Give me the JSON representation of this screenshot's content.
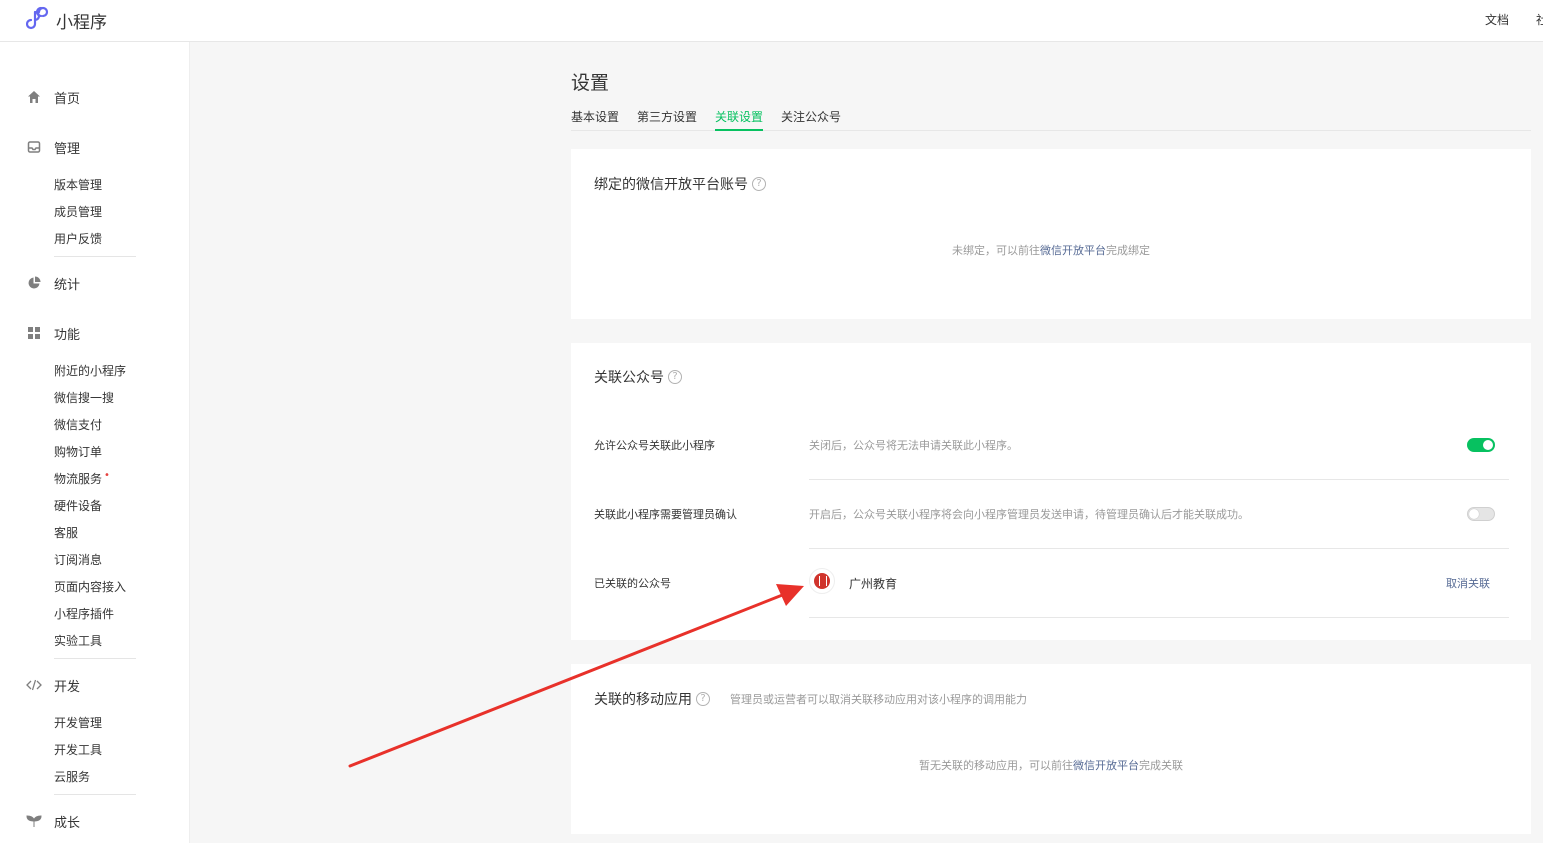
{
  "header": {
    "app_name": "小程序",
    "docs_link": "文档",
    "cut_link": "社"
  },
  "sidebar": {
    "home": "首页",
    "manage": {
      "label": "管理",
      "items": [
        "版本管理",
        "成员管理",
        "用户反馈"
      ]
    },
    "stats": "统计",
    "features": {
      "label": "功能",
      "items": [
        "附近的小程序",
        "微信搜一搜",
        "微信支付",
        "购物订单",
        "物流服务",
        "硬件设备",
        "客服",
        "订阅消息",
        "页面内容接入",
        "小程序插件",
        "实验工具"
      ],
      "badge": "•"
    },
    "dev": {
      "label": "开发",
      "items": [
        "开发管理",
        "开发工具",
        "云服务"
      ]
    },
    "growth": "成长"
  },
  "page": {
    "title": "设置",
    "tabs": [
      "基本设置",
      "第三方设置",
      "关联设置",
      "关注公众号"
    ],
    "active_tab": 2
  },
  "open_platform": {
    "title": "绑定的微信开放平台账号",
    "help": "?",
    "empty_prefix": "未绑定，可以前往",
    "empty_link": "微信开放平台",
    "empty_suffix": "完成绑定"
  },
  "official_account": {
    "title": "关联公众号",
    "help": "?",
    "allow_label": "允许公众号关联此小程序",
    "allow_desc": "关闭后，公众号将无法申请关联此小程序。",
    "allow_on": true,
    "confirm_label": "关联此小程序需要管理员确认",
    "confirm_desc": "开启后，公众号关联小程序将会向小程序管理员发送申请，待管理员确认后才能关联成功。",
    "confirm_on": false,
    "linked_label": "已关联的公众号",
    "linked_name": "广州教育",
    "unlink": "取消关联"
  },
  "mobile_app": {
    "title": "关联的移动应用",
    "help": "?",
    "desc": "管理员或运营者可以取消关联移动应用对该小程序的调用能力",
    "empty_prefix": "暂无关联的移动应用，可以前往",
    "empty_link": "微信开放平台",
    "empty_suffix": "完成关联"
  },
  "colors": {
    "accent": "#07c160",
    "link": "#576b95",
    "arrow": "#e8312a"
  }
}
